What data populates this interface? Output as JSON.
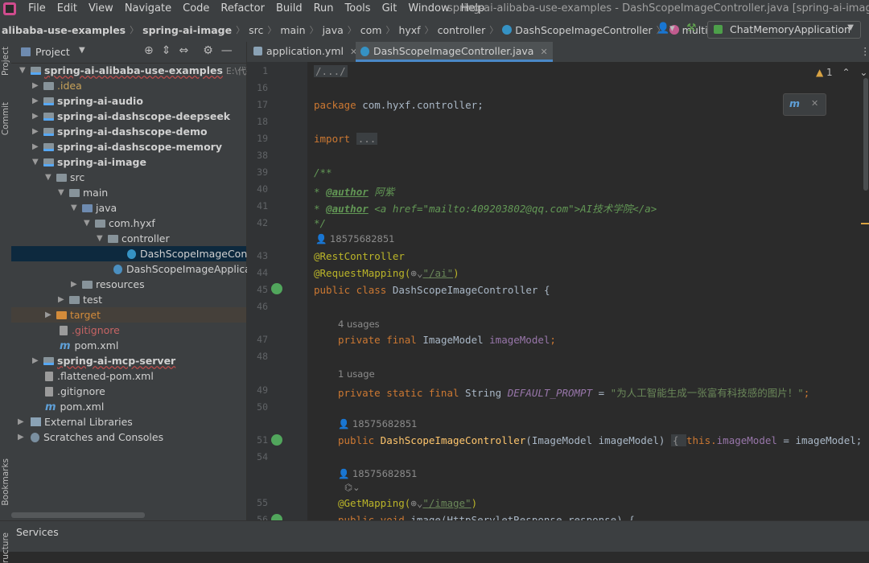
{
  "menubar": {
    "items": [
      "File",
      "Edit",
      "View",
      "Navigate",
      "Code",
      "Refactor",
      "Build",
      "Run",
      "Tools",
      "Git",
      "Window",
      "Help"
    ],
    "window_title": "spring-ai-alibaba-use-examples - DashScopeImageController.java [spring-ai-image]"
  },
  "breadcrumbs": [
    "alibaba-use-examples",
    "spring-ai-image",
    "src",
    "main",
    "java",
    "com",
    "hyxf",
    "controller",
    "DashScopeImageController",
    "multipleConditions"
  ],
  "run_config": "ChatMemoryApplication",
  "sidestrip": {
    "project": "Project",
    "commit": "Commit",
    "bookmarks": "Bookmarks",
    "structure": "ructure"
  },
  "project_panel": {
    "title": "Project",
    "tree": [
      {
        "name": "spring-ai-alibaba-use-examples",
        "path": "E:\\代码前端\\"
      },
      {
        "name": ".idea"
      },
      {
        "name": "spring-ai-audio"
      },
      {
        "name": "spring-ai-dashscope-deepseek"
      },
      {
        "name": "spring-ai-dashscope-demo"
      },
      {
        "name": "spring-ai-dashscope-memory"
      },
      {
        "name": "spring-ai-image"
      },
      {
        "name": "src"
      },
      {
        "name": "main"
      },
      {
        "name": "java"
      },
      {
        "name": "com.hyxf"
      },
      {
        "name": "controller"
      },
      {
        "name": "DashScopeImageController"
      },
      {
        "name": "DashScopeImageApplication"
      },
      {
        "name": "resources"
      },
      {
        "name": "test"
      },
      {
        "name": "target"
      },
      {
        "name": ".gitignore"
      },
      {
        "name": "pom.xml"
      },
      {
        "name": "spring-ai-mcp-server"
      },
      {
        "name": ".flattened-pom.xml"
      },
      {
        "name": ".gitignore"
      },
      {
        "name": "pom.xml"
      },
      {
        "name": "External Libraries"
      },
      {
        "name": "Scratches and Consoles"
      }
    ]
  },
  "tabs": [
    {
      "label": "application.yml"
    },
    {
      "label": "DashScopeImageController.java"
    }
  ],
  "editor": {
    "warning": "1",
    "line_numbers": [
      "1",
      "16",
      "17",
      "18",
      "19",
      "38",
      "39",
      "40",
      "41",
      "42",
      "43",
      "44",
      "45",
      "46",
      "47",
      "48",
      "49",
      "50",
      "51",
      "54",
      "55",
      "56"
    ],
    "author_hint": "18575682851",
    "usages_4": "4 usages",
    "usages_1": "1 usage",
    "code": {
      "l1": "/.../",
      "pkg_kw": "package",
      "pkg": " com.hyxf.controller;",
      "imp_kw": "import",
      "imp": "...",
      "doc_open": "/**",
      "doc_star": " * ",
      "author_tag": "@author",
      "author1": " 阿紫",
      "author2_pre": " <a href=\"mailto:409203802@qq.com\">AI技术学院</a>",
      "doc_close": " */",
      "rest": "@RestController",
      "reqmap": "@RequestMapping(",
      "reqmap_path": "\"/ai\"",
      "reqmap_close": ")",
      "cls_kw": "public class",
      "cls": " DashScopeImageController {",
      "f1_kw": "private final",
      "f1_type": " ImageModel ",
      "f1_name": "imageModel",
      "f1_end": ";",
      "f2_kw": "private static final",
      "f2_type": " String ",
      "f2_name": "DEFAULT_PROMPT",
      "f2_eq": " = ",
      "f2_str": "\"为人工智能生成一张富有科技感的图片！\"",
      "f2_end": ";",
      "ctor_kw": "public",
      "ctor_name": " DashScopeImageController",
      "ctor_args": "(ImageModel imageModel) ",
      "ctor_body_open": "{ ",
      "ctor_this": "this.",
      "ctor_fld": "imageModel",
      "ctor_rest": " = imageModel;",
      "getmap": "@GetMapping(",
      "getmap_path": "\"/image\"",
      "getmap_close": ")",
      "last_kw": "public void",
      "last_rest": " image(HttpServletResponse response) {"
    }
  },
  "bottom": {
    "services": "Services"
  }
}
